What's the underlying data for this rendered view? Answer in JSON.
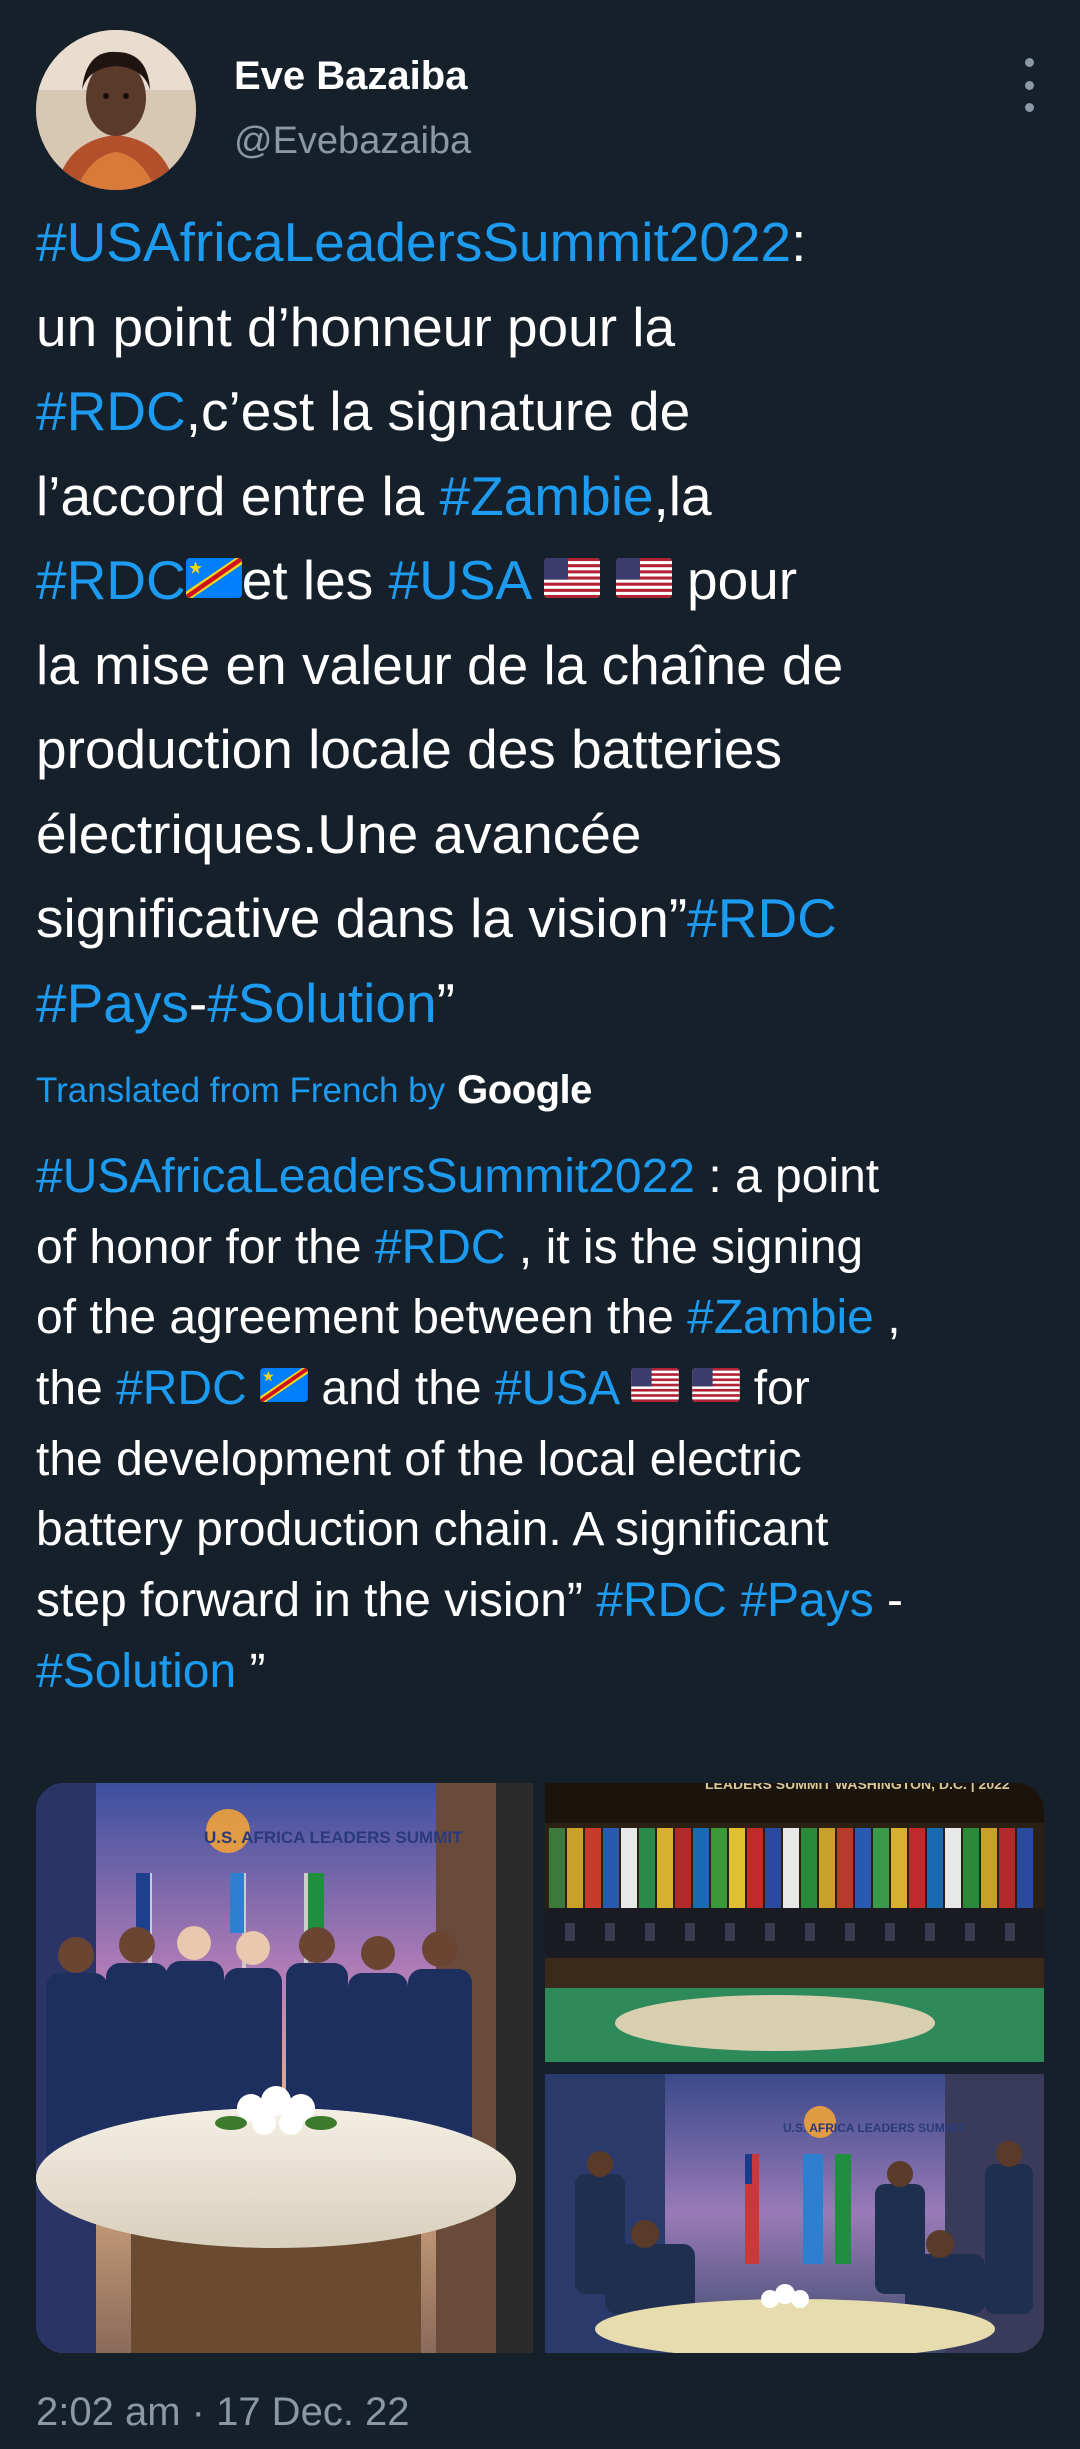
{
  "author": {
    "name": "Eve Bazaiba",
    "handle": "@Evebazaiba"
  },
  "tweet": {
    "original_lines": [
      [
        {
          "t": "#USAfricaLeadersSummit2022",
          "tag": true
        },
        {
          "t": ":"
        }
      ],
      [
        {
          "t": "un point d’honneur pour la"
        }
      ],
      [
        {
          "t": "#RDC",
          "tag": true
        },
        {
          "t": ",c’est la signature de"
        }
      ],
      [
        {
          "t": "l’accord entre la "
        },
        {
          "t": "#Zambie",
          "tag": true
        },
        {
          "t": ",la"
        }
      ],
      [
        {
          "t": "#RDC",
          "tag": true
        },
        {
          "flag": "cd"
        },
        {
          "t": "et les "
        },
        {
          "t": "#USA",
          "tag": true
        },
        {
          "t": " "
        },
        {
          "flag": "us"
        },
        {
          "t": " "
        },
        {
          "flag": "us"
        },
        {
          "t": " pour"
        }
      ],
      [
        {
          "t": "la mise en valeur de la chaîne de"
        }
      ],
      [
        {
          "t": "production locale des batteries"
        }
      ],
      [
        {
          "t": "électriques.Une avancée"
        }
      ],
      [
        {
          "t": "significative dans la vision”"
        },
        {
          "t": "#RDC",
          "tag": true
        }
      ],
      [
        {
          "t": "#Pays",
          "tag": true
        },
        {
          "t": "-"
        },
        {
          "t": "#Solution",
          "tag": true
        },
        {
          "t": "”"
        }
      ]
    ],
    "translated_label": "Translated from French by",
    "translated_brand": "Google",
    "translation_lines": [
      [
        {
          "t": "#USAfricaLeadersSummit2022",
          "tag": true
        },
        {
          "t": " : a point"
        }
      ],
      [
        {
          "t": "of honor for the "
        },
        {
          "t": "#RDC",
          "tag": true
        },
        {
          "t": " , it is the signing"
        }
      ],
      [
        {
          "t": "of the agreement between the "
        },
        {
          "t": "#Zambie",
          "tag": true
        },
        {
          "t": " ,"
        }
      ],
      [
        {
          "t": "the "
        },
        {
          "t": "#RDC",
          "tag": true
        },
        {
          "t": " "
        },
        {
          "flag": "cd"
        },
        {
          "t": " and the "
        },
        {
          "t": "#USA",
          "tag": true
        },
        {
          "t": " "
        },
        {
          "flag": "us"
        },
        {
          "t": "  "
        },
        {
          "flag": "us"
        },
        {
          "t": " for"
        }
      ],
      [
        {
          "t": "the development of the local electric"
        }
      ],
      [
        {
          "t": "battery production chain. A significant"
        }
      ],
      [
        {
          "t": "step forward in the vision” "
        },
        {
          "t": "#RDC",
          "tag": true
        },
        {
          "t": " "
        },
        {
          "t": "#Pays",
          "tag": true
        },
        {
          "t": " -"
        }
      ],
      [
        {
          "t": "#Solution",
          "tag": true
        },
        {
          "t": " ”"
        }
      ]
    ]
  },
  "media": {
    "photos": [
      {
        "name": "photo-leaders-group",
        "banner": "U.S. AFRICA LEADERS SUMMIT"
      },
      {
        "name": "photo-summit-hall",
        "banner": "LEADERS SUMMIT WASHINGTON, D.C. | 2022"
      },
      {
        "name": "photo-signing",
        "banner": "U.S. AFRICA LEADERS SUMMIT"
      }
    ]
  },
  "timestamp": "2:02 am · 17 Dec. 22",
  "colors": {
    "background": "#15202b",
    "link": "#1d9bf0",
    "secondary_text": "#8b98a5"
  }
}
